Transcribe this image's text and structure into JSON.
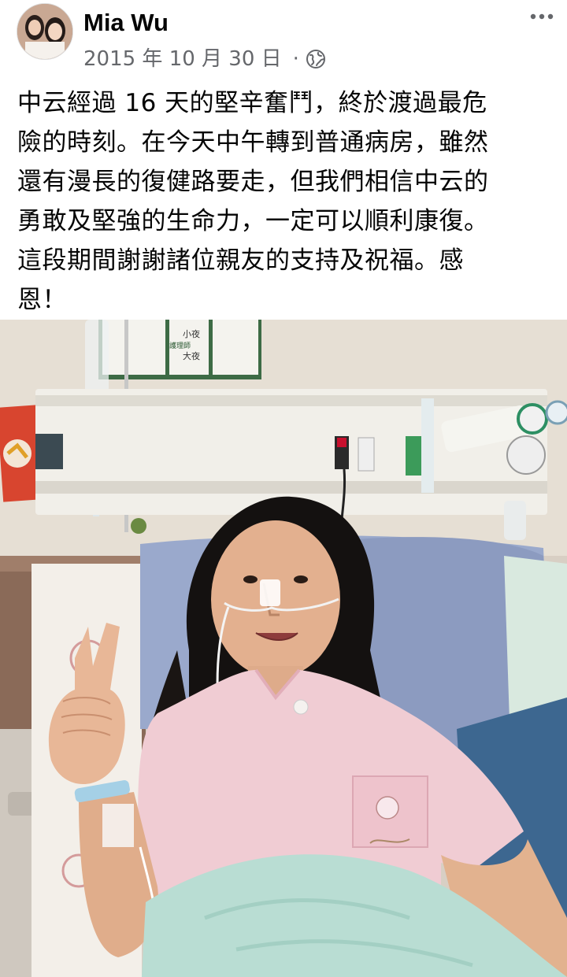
{
  "post": {
    "author": "Mia Wu",
    "date": "2015 年 10 月 30 日",
    "separator": "·",
    "privacy_icon": "globe-icon",
    "more_icon": "more-horizontal-icon",
    "text": "中云經過 16 天的堅辛奮鬥，終於渡過最危\n險的時刻。在今天中午轉到普通病房，雖然\n還有漫長的復健路要走，但我們相信中云的\n勇敢及堅強的生命力，一定可以順利康復。\n這段期間謝謝諸位親友的支持及祝福。感\n恩！"
  },
  "photo": {
    "subject": "girl in hospital bed giving peace sign",
    "sign_lines": [
      "小夜",
      "大夜"
    ],
    "sign_small": [
      "護理師"
    ]
  },
  "colors": {
    "secondary_text": "#65676b",
    "wall": "#e6dfd4",
    "pillow": "#9aa9cc",
    "pajama": "#f0ccd3",
    "blanket": "#b9ddd3"
  }
}
